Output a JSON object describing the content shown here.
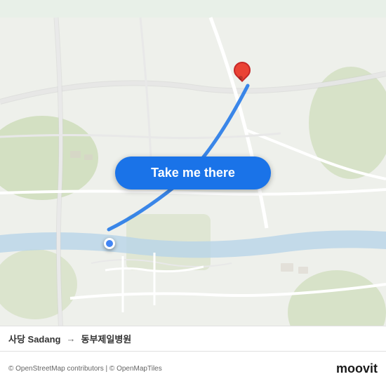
{
  "map": {
    "background_color": "#eef0eb",
    "attribution": "© OpenStreetMap contributors | © OpenMapTiles"
  },
  "button": {
    "label": "Take me there"
  },
  "route": {
    "from": "사당 Sadang",
    "arrow": "→",
    "to": "동부제일병원"
  },
  "branding": {
    "name": "moovit"
  },
  "icons": {
    "arrow": "→"
  }
}
